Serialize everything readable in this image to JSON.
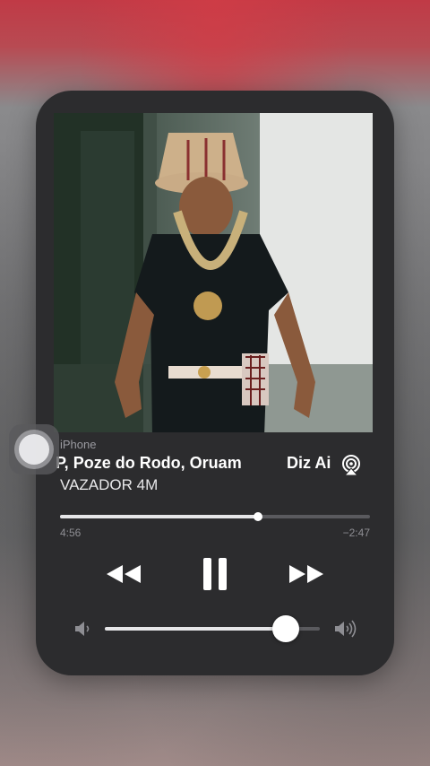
{
  "now_playing": {
    "source": "iPhone",
    "title_visible": "P, Poze do Rodo, Oruam",
    "title_next_visible": "Diz Ai",
    "artist_visible": "VAZADOR 4M",
    "elapsed": "4:56",
    "remaining": "−2:47",
    "progress_fraction": 0.64,
    "volume_fraction": 0.84
  },
  "icons": {
    "airplay": "airplay-icon",
    "previous": "rewind-icon",
    "play_pause": "pause-icon",
    "next": "fast-forward-icon",
    "volume_low": "speaker-low-icon",
    "volume_high": "speaker-high-icon"
  },
  "colors": {
    "card_bg": "#2c2c2e",
    "text_primary": "#ffffff",
    "text_secondary": "#8e8e93",
    "track": "#5a5a5e",
    "fill": "#e6e6e8"
  }
}
